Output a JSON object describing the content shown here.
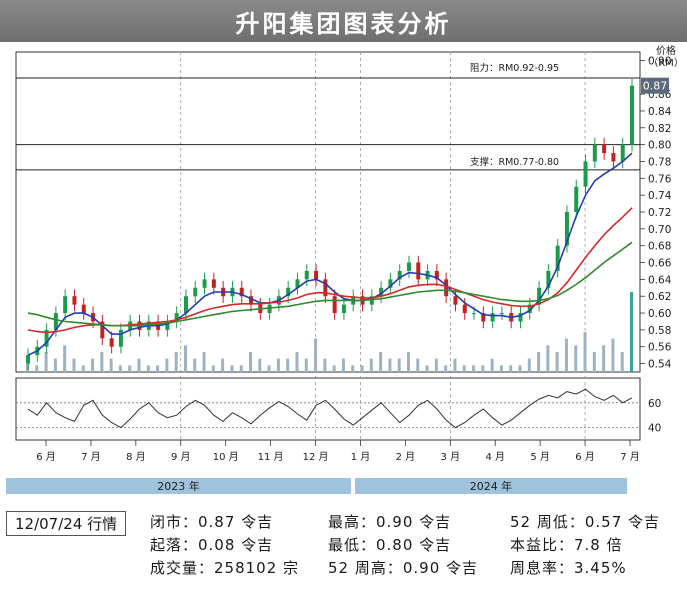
{
  "title": "升阳集团图表分析",
  "chart_data": {
    "type": "candlestick",
    "y_axis_label": "价格\n（RM）",
    "ylim": [
      0.53,
      0.91
    ],
    "y_ticks": [
      "0.90",
      "0.86",
      "0.84",
      "0.82",
      "0.80",
      "0.78",
      "0.76",
      "0.74",
      "0.72",
      "0.70",
      "0.68",
      "0.66",
      "0.64",
      "0.62",
      "0.60",
      "0.58",
      "0.56",
      "0.54"
    ],
    "current_price_label": "0.87",
    "resistance": {
      "label": "阻力：RM0.92-0.95"
    },
    "support": {
      "label": "支撑：RM0.77-0.80",
      "low": 0.77,
      "high": 0.8
    },
    "x_month_labels": [
      "6 月",
      "7 月",
      "8 月",
      "9 月",
      "10 月",
      "11 月",
      "12 月",
      "1 月",
      "2 月",
      "3 月",
      "4 月",
      "5 月",
      "6 月",
      "7 月"
    ],
    "close_series": [
      0.55,
      0.56,
      0.58,
      0.6,
      0.62,
      0.61,
      0.6,
      0.59,
      0.57,
      0.56,
      0.58,
      0.59,
      0.58,
      0.59,
      0.58,
      0.59,
      0.6,
      0.62,
      0.63,
      0.64,
      0.63,
      0.62,
      0.63,
      0.62,
      0.61,
      0.6,
      0.61,
      0.62,
      0.63,
      0.64,
      0.65,
      0.64,
      0.62,
      0.6,
      0.61,
      0.62,
      0.61,
      0.62,
      0.63,
      0.64,
      0.65,
      0.66,
      0.64,
      0.65,
      0.64,
      0.62,
      0.61,
      0.6,
      0.6,
      0.59,
      0.6,
      0.6,
      0.59,
      0.6,
      0.61,
      0.63,
      0.65,
      0.68,
      0.72,
      0.75,
      0.78,
      0.8,
      0.79,
      0.78,
      0.8,
      0.87
    ],
    "ma_series": [
      {
        "color": "#1f3fb0",
        "values": [
          0.55,
          0.555,
          0.565,
          0.58,
          0.595,
          0.6,
          0.6,
          0.595,
          0.585,
          0.575,
          0.575,
          0.58,
          0.583,
          0.585,
          0.585,
          0.587,
          0.592,
          0.6,
          0.61,
          0.62,
          0.625,
          0.625,
          0.625,
          0.622,
          0.617,
          0.612,
          0.612,
          0.615,
          0.622,
          0.63,
          0.638,
          0.64,
          0.635,
          0.625,
          0.617,
          0.615,
          0.615,
          0.617,
          0.623,
          0.632,
          0.642,
          0.648,
          0.647,
          0.645,
          0.642,
          0.633,
          0.622,
          0.612,
          0.605,
          0.598,
          0.597,
          0.597,
          0.595,
          0.597,
          0.603,
          0.615,
          0.632,
          0.655,
          0.685,
          0.715,
          0.74,
          0.757,
          0.765,
          0.772,
          0.78,
          0.79
        ]
      },
      {
        "color": "#d42a2a",
        "values": [
          0.58,
          0.578,
          0.577,
          0.578,
          0.58,
          0.583,
          0.585,
          0.586,
          0.586,
          0.585,
          0.585,
          0.586,
          0.587,
          0.588,
          0.589,
          0.59,
          0.592,
          0.595,
          0.599,
          0.603,
          0.606,
          0.608,
          0.61,
          0.611,
          0.611,
          0.611,
          0.612,
          0.613,
          0.615,
          0.618,
          0.622,
          0.624,
          0.624,
          0.622,
          0.62,
          0.619,
          0.618,
          0.618,
          0.62,
          0.623,
          0.627,
          0.631,
          0.633,
          0.634,
          0.634,
          0.632,
          0.628,
          0.624,
          0.62,
          0.616,
          0.613,
          0.611,
          0.609,
          0.608,
          0.608,
          0.611,
          0.616,
          0.624,
          0.636,
          0.651,
          0.666,
          0.68,
          0.693,
          0.704,
          0.714,
          0.725
        ]
      },
      {
        "color": "#2e8b2e",
        "values": [
          0.6,
          0.598,
          0.595,
          0.592,
          0.59,
          0.589,
          0.588,
          0.587,
          0.586,
          0.585,
          0.585,
          0.585,
          0.585,
          0.586,
          0.587,
          0.588,
          0.59,
          0.592,
          0.594,
          0.596,
          0.598,
          0.6,
          0.602,
          0.603,
          0.604,
          0.605,
          0.606,
          0.607,
          0.608,
          0.61,
          0.612,
          0.614,
          0.615,
          0.615,
          0.615,
          0.615,
          0.615,
          0.616,
          0.617,
          0.619,
          0.621,
          0.623,
          0.625,
          0.626,
          0.627,
          0.627,
          0.626,
          0.624,
          0.622,
          0.62,
          0.618,
          0.616,
          0.615,
          0.614,
          0.614,
          0.615,
          0.617,
          0.621,
          0.627,
          0.634,
          0.642,
          0.651,
          0.66,
          0.668,
          0.676,
          0.684
        ]
      }
    ],
    "volume": [
      2,
      1,
      3,
      2,
      4,
      2,
      1,
      2,
      3,
      2,
      1,
      1,
      2,
      1,
      1,
      2,
      3,
      4,
      2,
      3,
      1,
      2,
      1,
      1,
      3,
      2,
      1,
      2,
      2,
      3,
      2,
      5,
      2,
      1,
      2,
      1,
      1,
      2,
      3,
      2,
      2,
      3,
      2,
      1,
      2,
      1,
      2,
      1,
      1,
      1,
      2,
      1,
      1,
      1,
      2,
      3,
      4,
      3,
      5,
      4,
      6,
      3,
      4,
      5,
      3,
      12
    ],
    "oscillator": {
      "ylim": [
        30,
        80
      ],
      "y_ticks": [
        "60",
        "40"
      ],
      "values": [
        55,
        50,
        60,
        52,
        48,
        45,
        58,
        62,
        50,
        44,
        40,
        47,
        55,
        60,
        52,
        48,
        50,
        57,
        62,
        58,
        50,
        45,
        52,
        48,
        43,
        50,
        56,
        61,
        57,
        51,
        46,
        58,
        62,
        55,
        47,
        42,
        48,
        54,
        60,
        52,
        44,
        50,
        58,
        62,
        55,
        46,
        40,
        44,
        50,
        55,
        48,
        42,
        46,
        52,
        58,
        63,
        66,
        64,
        69,
        67,
        71,
        65,
        62,
        66,
        60,
        64
      ]
    }
  },
  "timeline": {
    "year_left": "2023 年",
    "year_right": "2024 年"
  },
  "stats": {
    "date": "12/07/24 行情",
    "close": "闭市：0.87 令吉",
    "high": "最高：0.90 令吉",
    "low52": "52 周低：0.57 令吉",
    "change": "起落：0.08 令吉",
    "low": "最低：0.80 令吉",
    "pe": "本益比：7.8 倍",
    "volume": "成交量：258102 宗",
    "high52": "52 周高：0.90 令吉",
    "yield": "周息率：3.45%"
  }
}
